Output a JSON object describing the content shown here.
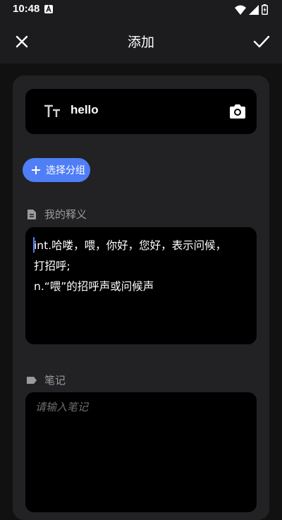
{
  "status_bar": {
    "time": "10:48",
    "icons": [
      "notification-a-icon",
      "wifi-icon",
      "signal-icon",
      "battery-charging-icon"
    ]
  },
  "toolbar": {
    "title": "添加",
    "close_icon": "close-icon",
    "confirm_icon": "check-icon"
  },
  "word": {
    "value": "hello",
    "type_icon": "text-size-icon",
    "camera_icon": "camera-icon"
  },
  "group": {
    "label": "选择分组",
    "icon": "plus-icon"
  },
  "definition": {
    "label": "我的释义",
    "icon": "document-icon",
    "text": "int.哈喽，喂，你好，您好，表示问候，\n打招呼;\nn.“喂”的招呼声或问候声"
  },
  "notes": {
    "label": "笔记",
    "icon": "label-icon",
    "placeholder": "请输入笔记"
  },
  "colors": {
    "accent": "#4f7ef7",
    "background": "#111111",
    "card": "#222224",
    "field": "#000000",
    "muted_text": "#9a9aa0"
  }
}
